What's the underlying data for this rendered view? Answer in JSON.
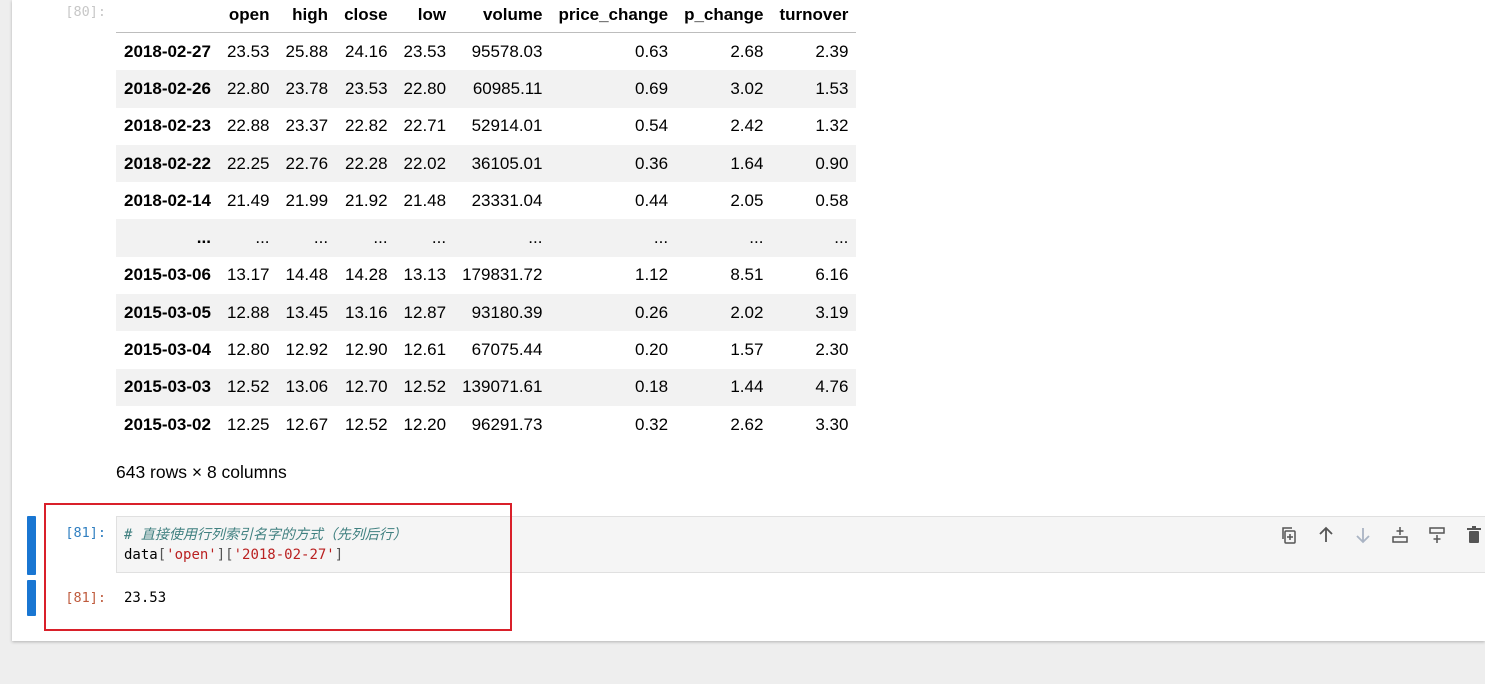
{
  "output80": {
    "prompt": "[80]:",
    "columns": [
      "",
      "open",
      "high",
      "close",
      "low",
      "volume",
      "price_change",
      "p_change",
      "turnover"
    ],
    "rows": [
      [
        "2018-02-27",
        "23.53",
        "25.88",
        "24.16",
        "23.53",
        "95578.03",
        "0.63",
        "2.68",
        "2.39"
      ],
      [
        "2018-02-26",
        "22.80",
        "23.78",
        "23.53",
        "22.80",
        "60985.11",
        "0.69",
        "3.02",
        "1.53"
      ],
      [
        "2018-02-23",
        "22.88",
        "23.37",
        "22.82",
        "22.71",
        "52914.01",
        "0.54",
        "2.42",
        "1.32"
      ],
      [
        "2018-02-22",
        "22.25",
        "22.76",
        "22.28",
        "22.02",
        "36105.01",
        "0.36",
        "1.64",
        "0.90"
      ],
      [
        "2018-02-14",
        "21.49",
        "21.99",
        "21.92",
        "21.48",
        "23331.04",
        "0.44",
        "2.05",
        "0.58"
      ],
      [
        "...",
        "...",
        "...",
        "...",
        "...",
        "...",
        "...",
        "...",
        "..."
      ],
      [
        "2015-03-06",
        "13.17",
        "14.48",
        "14.28",
        "13.13",
        "179831.72",
        "1.12",
        "8.51",
        "6.16"
      ],
      [
        "2015-03-05",
        "12.88",
        "13.45",
        "13.16",
        "12.87",
        "93180.39",
        "0.26",
        "2.02",
        "3.19"
      ],
      [
        "2015-03-04",
        "12.80",
        "12.92",
        "12.90",
        "12.61",
        "67075.44",
        "0.20",
        "1.57",
        "2.30"
      ],
      [
        "2015-03-03",
        "12.52",
        "13.06",
        "12.70",
        "12.52",
        "139071.61",
        "0.18",
        "1.44",
        "4.76"
      ],
      [
        "2015-03-02",
        "12.25",
        "12.67",
        "12.52",
        "12.20",
        "96291.73",
        "0.32",
        "2.62",
        "3.30"
      ]
    ],
    "shape_text": "643 rows × 8 columns"
  },
  "cell81": {
    "in_prompt": "[81]:",
    "comment": "# 直接使用行列索引名字的方式（先列后行）",
    "code_var": "data",
    "code_key1": "'open'",
    "code_key2": "'2018-02-27'",
    "out_prompt": "[81]:",
    "output": "23.53"
  },
  "toolbar": {
    "icons": [
      "duplicate-icon",
      "move-up-icon",
      "move-down-icon",
      "insert-above-icon",
      "insert-below-icon",
      "delete-icon"
    ]
  },
  "colors": {
    "accent": "#1976d2",
    "highlight": "#d9202a",
    "in_prompt": "#307fc1",
    "out_prompt": "#bf5b3d"
  }
}
